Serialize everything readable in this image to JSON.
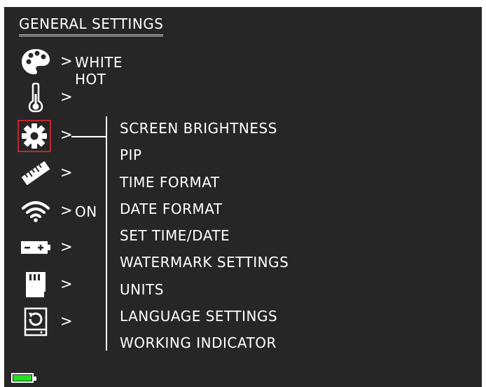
{
  "title": "GENERAL SETTINGS",
  "sidebar": {
    "items": [
      {
        "icon": "palette-icon",
        "value": "WHITE HOT"
      },
      {
        "icon": "thermometer-icon",
        "value": ""
      },
      {
        "icon": "gear-icon",
        "value": "",
        "selected": true
      },
      {
        "icon": "ruler-icon",
        "value": ""
      },
      {
        "icon": "wifi-icon",
        "value": "ON"
      },
      {
        "icon": "battery-settings-icon",
        "value": ""
      },
      {
        "icon": "sd-card-icon",
        "value": ""
      },
      {
        "icon": "restore-icon",
        "value": ""
      }
    ],
    "chevron": ">"
  },
  "submenu": {
    "items": [
      "SCREEN BRIGHTNESS",
      "PIP",
      "TIME FORMAT",
      "DATE FORMAT",
      "SET TIME/DATE",
      "WATERMARK SETTINGS",
      "UNITS",
      "LANGUAGE SETTINGS",
      "WORKING INDICATOR"
    ]
  },
  "status": {
    "battery_level": 1.0,
    "battery_color": "#21e021"
  },
  "colors": {
    "background": "#262626",
    "text": "#ffffff",
    "selection": "#c0272d"
  }
}
